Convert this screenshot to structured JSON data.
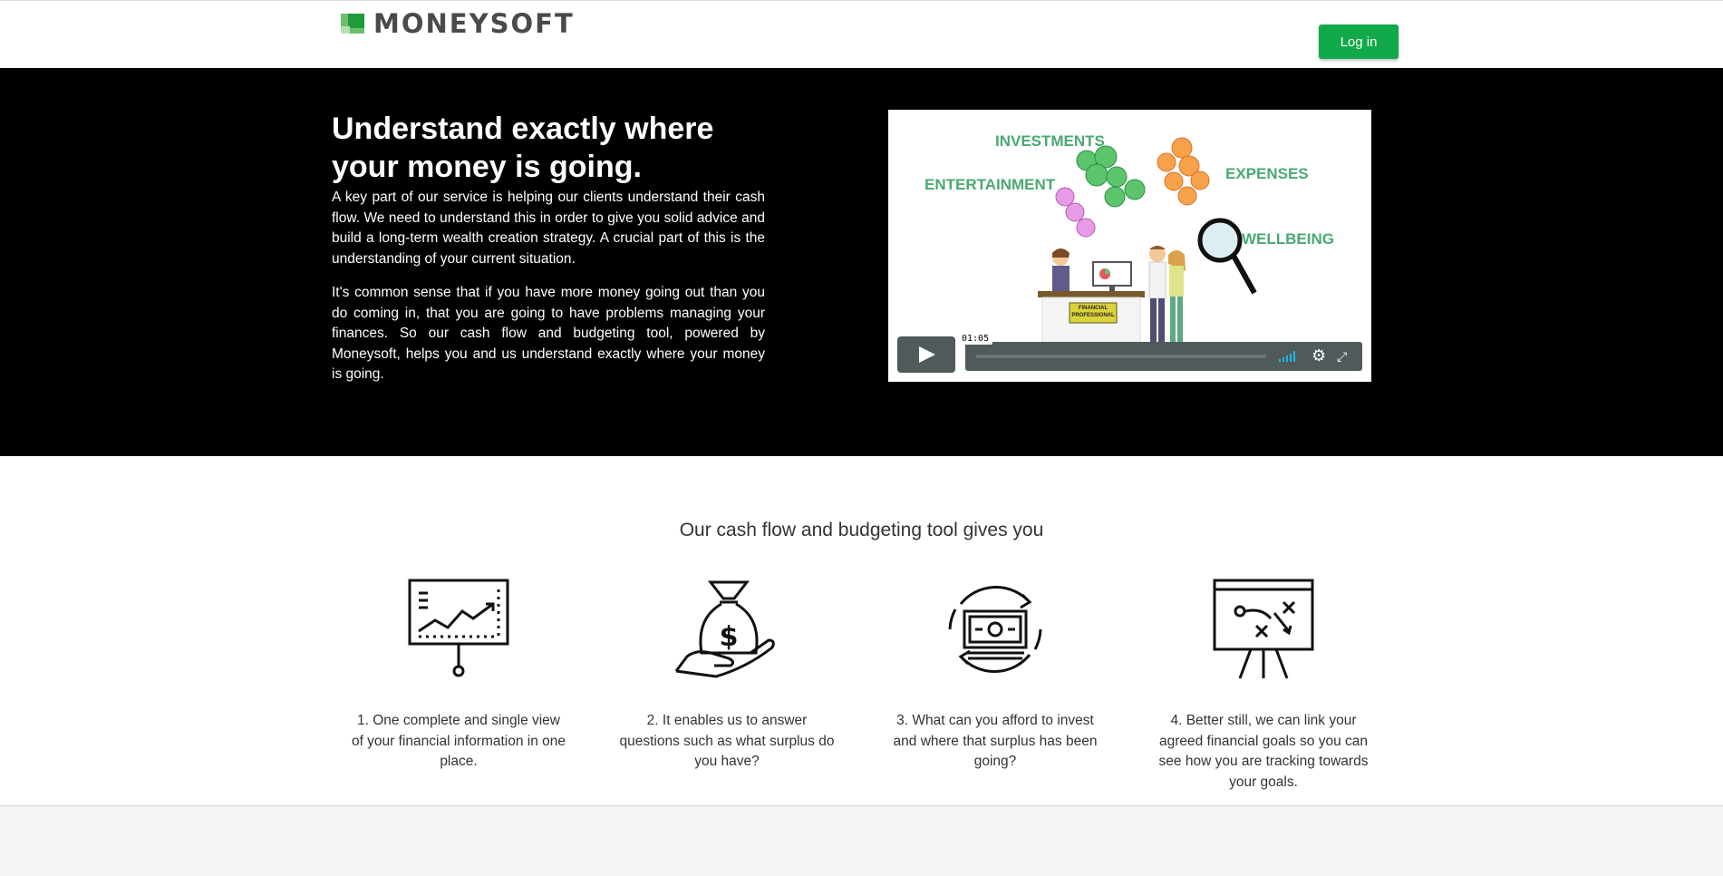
{
  "header": {
    "logo_text": "MONEYSOFT",
    "login_label": "Log in"
  },
  "hero": {
    "title": "Understand exactly where your money is going.",
    "paragraph1": "A key part of our service is helping our clients understand their cash flow. We need to understand this in order to give you solid advice and build a long-term wealth creation strategy. A crucial part of this is the understanding of your current situation.",
    "paragraph2": "It's common sense that if you have more money going out than you do coming in, that you are going to have problems managing your finances. So our cash flow and budgeting tool, powered by Moneysoft, helps you and us understand exactly where your money is going."
  },
  "video": {
    "labels": {
      "investments": "INVESTMENTS",
      "entertainment": "ENTERTAINMENT",
      "expenses": "EXPENSES",
      "wellbeing": "WELLBEING",
      "desk_sign": "FINANCIAL PROFESSIONAL"
    },
    "timecode": "01:05",
    "icons": {
      "play": "play-icon",
      "volume": "volume-icon",
      "settings": "gear-icon",
      "fullscreen": "fullscreen-icon"
    },
    "accent": "#1ab7ea"
  },
  "features": {
    "title": "Our cash flow and budgeting tool gives you",
    "items": [
      {
        "icon": "presentation-chart-icon",
        "text": "1. One complete and single view of your financial information in one place."
      },
      {
        "icon": "money-bag-hand-icon",
        "text": "2. It enables us to answer questions such as what surplus do you have?"
      },
      {
        "icon": "cash-cycle-icon",
        "text": "3. What can you afford to invest and where that surplus has been going?"
      },
      {
        "icon": "strategy-board-icon",
        "text": "4. Better still, we can link your agreed financial goals so you can see how you are tracking towards your goals."
      }
    ]
  },
  "colors": {
    "brand_green": "#12a94a",
    "hero_bg": "#000000",
    "label_green": "#4aa973"
  }
}
